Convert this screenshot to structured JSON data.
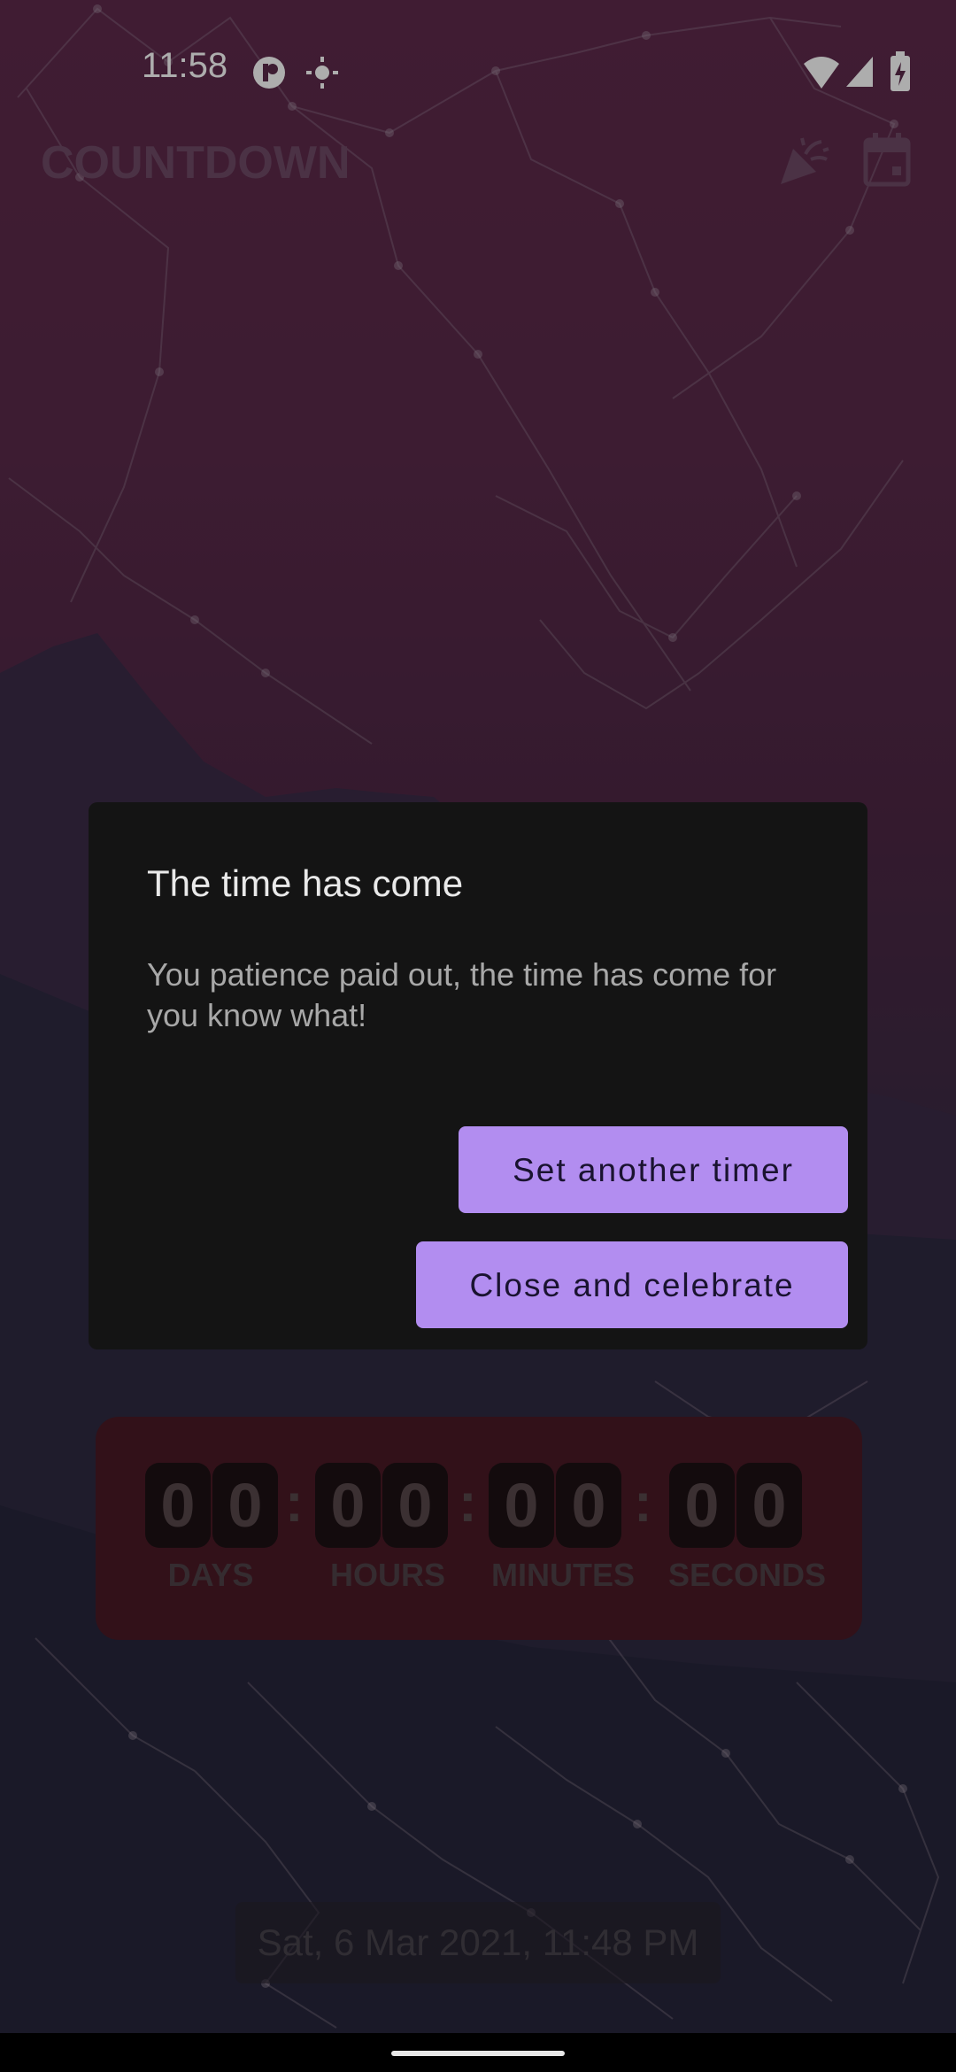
{
  "status_bar": {
    "time": "11:58",
    "icons": [
      "app-notification-icon",
      "brightness-icon",
      "wifi-icon",
      "cell-signal-icon",
      "battery-charging-icon"
    ]
  },
  "app_bar": {
    "title": "COUNTDOWN",
    "actions": [
      "celebrate-icon",
      "calendar-icon"
    ]
  },
  "countdown": {
    "days": [
      "0",
      "0"
    ],
    "hours": [
      "0",
      "0"
    ],
    "minutes": [
      "0",
      "0"
    ],
    "seconds": [
      "0",
      "0"
    ],
    "separator": ":",
    "labels": {
      "days": "DAYS",
      "hours": "HOURS",
      "minutes": "MINUTES",
      "seconds": "SECONDS"
    }
  },
  "target_date": "Sat, 6 Mar 2021, 11:48 PM",
  "dialog": {
    "title": "The time has come",
    "message": "You patience paid out, the time has come for you know what!",
    "buttons": {
      "set_another": "Set another timer",
      "close_celebrate": "Close and celebrate"
    }
  },
  "colors": {
    "accent": "#b28df0",
    "dialog_bg": "#141414"
  }
}
